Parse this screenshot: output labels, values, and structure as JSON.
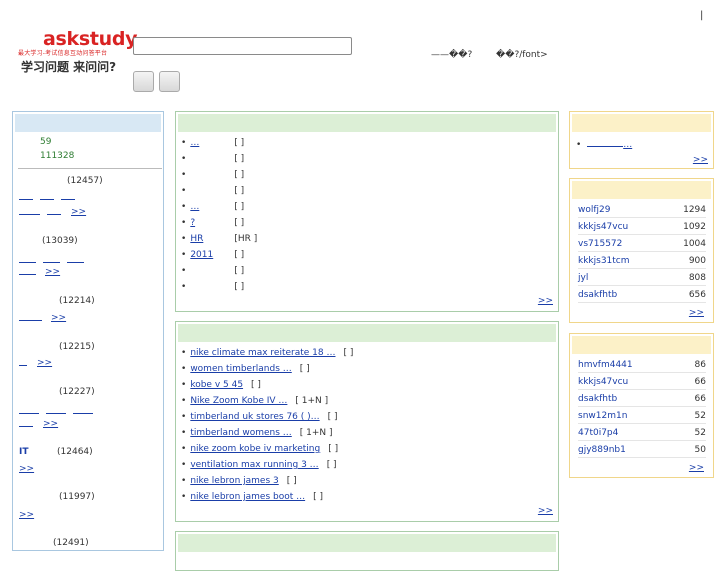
{
  "header": {
    "logo_word": "askstudy",
    "logo_sub": "最大学习-考试信息互动问答平台",
    "logo_slogan": "学习问题 来问问?",
    "top_links": [
      "——��?",
      "��?/font>"
    ],
    "pipe": "|"
  },
  "left_panel": {
    "stats": [
      "59",
      "111328"
    ],
    "categories": [
      {
        "count": "(12457)",
        "more": ">>"
      },
      {
        "count": "(13039)",
        "more": ">>"
      },
      {
        "count": "(12214)",
        "more": ">>"
      },
      {
        "count": "(12215)",
        "more": ">>"
      },
      {
        "count": "(12227)",
        "more": ">>"
      },
      {
        "label": "IT",
        "count": "(12464)",
        "more": ">>"
      },
      {
        "count": "(11997)",
        "more": ">>"
      },
      {
        "count": "(12491)"
      }
    ]
  },
  "center_top": {
    "items": [
      {
        "bullet": "•",
        "link": "…",
        "bracket": "[ ]"
      },
      {
        "bullet": "•",
        "link": "",
        "bracket": "[ ]"
      },
      {
        "bullet": "•",
        "link": "",
        "bracket": "[ ]"
      },
      {
        "bullet": "•",
        "link": "",
        "bracket": "[ ]"
      },
      {
        "bullet": "•",
        "link": "…",
        "bracket": "[ ]"
      },
      {
        "bullet": "•",
        "link": "?",
        "bracket": "[ ]"
      },
      {
        "bullet": "•",
        "link": "HR",
        "bracket": "[HR ]"
      },
      {
        "bullet": "•",
        "link": "2011",
        "bracket": "[ ]"
      },
      {
        "bullet": "•",
        "link": "",
        "bracket": "[ ]"
      },
      {
        "bullet": "•",
        "link": "",
        "bracket": "[ ]"
      }
    ],
    "more": ">>"
  },
  "center_bottom": {
    "items": [
      {
        "bullet": "•",
        "link": "nike climate max reiterate 18 …",
        "bracket": "[ ]"
      },
      {
        "bullet": "•",
        "link": "women timberlands …",
        "bracket": "[ ]"
      },
      {
        "bullet": "•",
        "link": "kobe v 5 45",
        "bracket": "[ ]"
      },
      {
        "bullet": "•",
        "link": "Nike Zoom Kobe IV …",
        "bracket": "[ 1+N ]"
      },
      {
        "bullet": "•",
        "link": "timberland uk stores 76 ( )…",
        "bracket": "[ ]"
      },
      {
        "bullet": "•",
        "link": "timberland womens …",
        "bracket": "[ 1+N ]"
      },
      {
        "bullet": "•",
        "link": "nike zoom kobe iv marketing",
        "bracket": "[ ]"
      },
      {
        "bullet": "•",
        "link": "ventilation max running 3 …",
        "bracket": "[ ]"
      },
      {
        "bullet": "•",
        "link": "nike lebron james 3",
        "bracket": "[ ]"
      },
      {
        "bullet": "•",
        "link": "nike lebron james boot …",
        "bracket": "[ ]"
      }
    ],
    "more": ">>"
  },
  "right_top": {
    "item": "…",
    "bullet": "•",
    "more": ">>"
  },
  "rank1": {
    "rows": [
      {
        "name": "wolfj29",
        "value": "1294"
      },
      {
        "name": "kkkjs47vcu",
        "value": "1092"
      },
      {
        "name": "vs715572",
        "value": "1004"
      },
      {
        "name": "kkkjs31tcm",
        "value": "900"
      },
      {
        "name": "jyl",
        "value": "808"
      },
      {
        "name": "dsakfhtb",
        "value": "656"
      }
    ],
    "more": ">>"
  },
  "rank2": {
    "rows": [
      {
        "name": "hmvfm4441",
        "value": "86"
      },
      {
        "name": "kkkjs47vcu",
        "value": "66"
      },
      {
        "name": "dsakfhtb",
        "value": "66"
      },
      {
        "name": "snw12m1n",
        "value": "52"
      },
      {
        "name": "47t0i7p4",
        "value": "52"
      },
      {
        "name": "gjy889nb1",
        "value": "50"
      }
    ],
    "more": ">>"
  }
}
